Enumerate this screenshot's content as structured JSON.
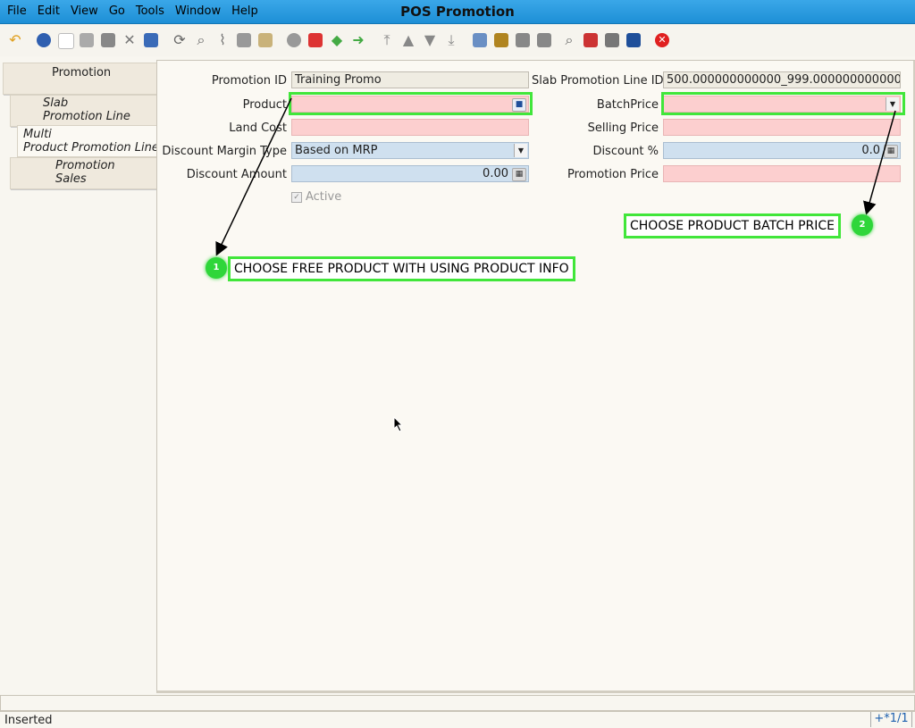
{
  "window": {
    "title": "POS Promotion"
  },
  "menu": [
    {
      "label": "File"
    },
    {
      "label": "Edit"
    },
    {
      "label": "View"
    },
    {
      "label": "Go"
    },
    {
      "label": "Tools"
    },
    {
      "label": "Window"
    },
    {
      "label": "Help"
    }
  ],
  "tabs": [
    {
      "l1": "Promotion",
      "l2": ""
    },
    {
      "l1": "Slab",
      "l2": "Promotion Line"
    },
    {
      "l1": "Multi",
      "l2": "Product Promotion Line"
    },
    {
      "l1": "Promotion",
      "l2": "Sales"
    }
  ],
  "form": {
    "promotion_id": {
      "label": "Promotion ID",
      "value": "Training Promo"
    },
    "slab_line_id": {
      "label": "Slab Promotion Line ID",
      "value": "500.000000000000_999.000000000000"
    },
    "product": {
      "label": "Product",
      "value": ""
    },
    "batch_price": {
      "label": "BatchPrice",
      "value": ""
    },
    "land_cost": {
      "label": "Land Cost",
      "value": ""
    },
    "selling_price": {
      "label": "Selling Price",
      "value": ""
    },
    "discount_margin_type": {
      "label": "Discount Margin Type",
      "value": "Based on MRP"
    },
    "discount_pct": {
      "label": "Discount %",
      "value": "0.0"
    },
    "discount_amount": {
      "label": "Discount Amount",
      "value": "0.00"
    },
    "promotion_price": {
      "label": "Promotion Price",
      "value": ""
    },
    "active": {
      "label": "Active"
    }
  },
  "annotations": {
    "a1": {
      "num": "1",
      "text": "CHOOSE FREE PRODUCT WITH USING PRODUCT INFO"
    },
    "a2": {
      "num": "2",
      "text": "CHOOSE PRODUCT BATCH PRICE"
    },
    "highlight_color": "#41e63a"
  },
  "status": {
    "text": "Inserted",
    "record": "+*1/1"
  }
}
